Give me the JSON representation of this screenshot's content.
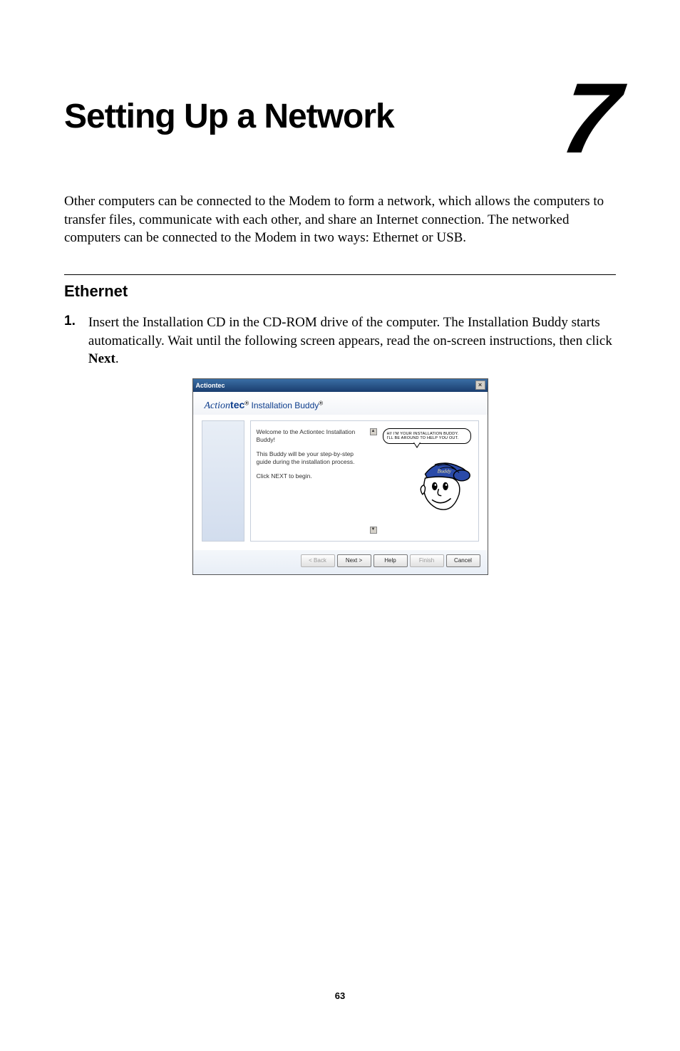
{
  "chapter": {
    "title": "Setting Up a Network",
    "number": "7",
    "intro": "Other computers can be connected to the Modem to form a network, which allows the computers to transfer files, communicate with each other, and share an Internet connection. The networked computers can be connected to the Modem in two ways: Ethernet or USB."
  },
  "section": {
    "heading": "Ethernet"
  },
  "step1": {
    "number": "1.",
    "prefix": "Insert the Installation ",
    "cd": "CD",
    "mid1": " in the ",
    "cdrom": "CD-ROM",
    "mid2": " drive of the computer. The Installation Buddy starts automatically. Wait until the following screen appears, read the on-screen instructions, then click ",
    "nextbold": "Next",
    "suffix": "."
  },
  "app": {
    "titlebar": "Actiontec",
    "close_char": "×",
    "brand_italic": "Action",
    "brand_bold": "tec",
    "brand_sub": " Installation Buddy",
    "brand_reg": "®",
    "instr_p1": "Welcome to the Actiontec Installation Buddy!",
    "instr_p2": "This Buddy will be your step-by-step guide during the installation process.",
    "instr_p3": "Click NEXT to begin.",
    "scroll_up": "▲",
    "scroll_down": "▼",
    "speech_l1": "HI! I'M YOUR INSTALLATION BUDDY.",
    "speech_l2": "I'LL BE AROUND TO HELP YOU OUT.",
    "cap_label": "Buddy",
    "buttons": {
      "back": "< Back",
      "next": "Next >",
      "help": "Help",
      "finish": "Finish",
      "cancel": "Cancel"
    }
  },
  "page_number": "63"
}
